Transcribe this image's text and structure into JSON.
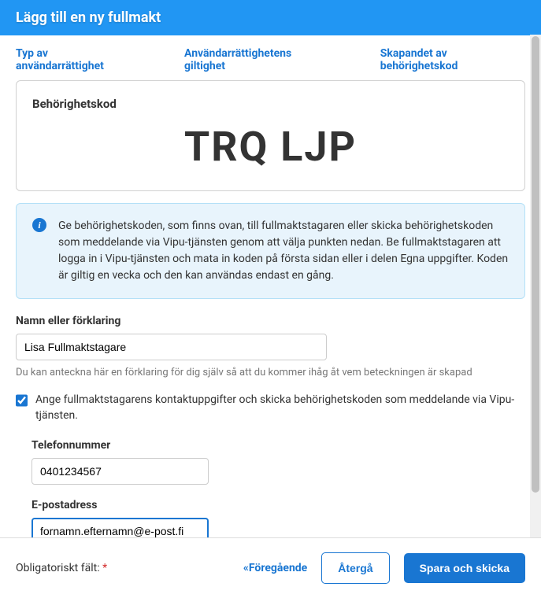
{
  "dialog": {
    "title": "Lägg till en ny fullmakt"
  },
  "steps": {
    "step1": "Typ av användarrättighet",
    "step2": "Användarrättighetens giltighet",
    "step3": "Skapandet av behörighetskod"
  },
  "codePanel": {
    "label": "Behörighetskod",
    "value": "TRQ LJP"
  },
  "info": {
    "text": "Ge behörighetskoden, som finns ovan, till fullmaktstagaren eller skicka behörighetskoden som meddelande via Vipu-tjänsten genom att välja punkten nedan. Be fullmaktstagaren att logga in i Vipu-tjänsten och mata in koden på första sidan eller i delen Egna uppgifter. Koden är giltig en vecka och den kan användas endast en gång."
  },
  "fields": {
    "name": {
      "label": "Namn eller förklaring",
      "value": "Lisa Fullmaktstagare",
      "help": "Du kan anteckna här en förklaring för dig själv så att du kommer ihåg åt vem beteckningen är skapad"
    },
    "sendContact": {
      "label": "Ange fullmaktstagarens kontaktuppgifter och skicka behörighetskoden som meddelande via Vipu-tjänsten.",
      "checked": true
    },
    "phone": {
      "label": "Telefonnummer",
      "value": "0401234567"
    },
    "email": {
      "label": "E-postadress",
      "value": "fornamn.efternamn@e-post.fi"
    }
  },
  "footer": {
    "requiredLabel": "Obligatoriskt fält:",
    "asterisk": "*",
    "previous": "Föregående",
    "cancel": "Återgå",
    "submit": "Spara och skicka"
  }
}
